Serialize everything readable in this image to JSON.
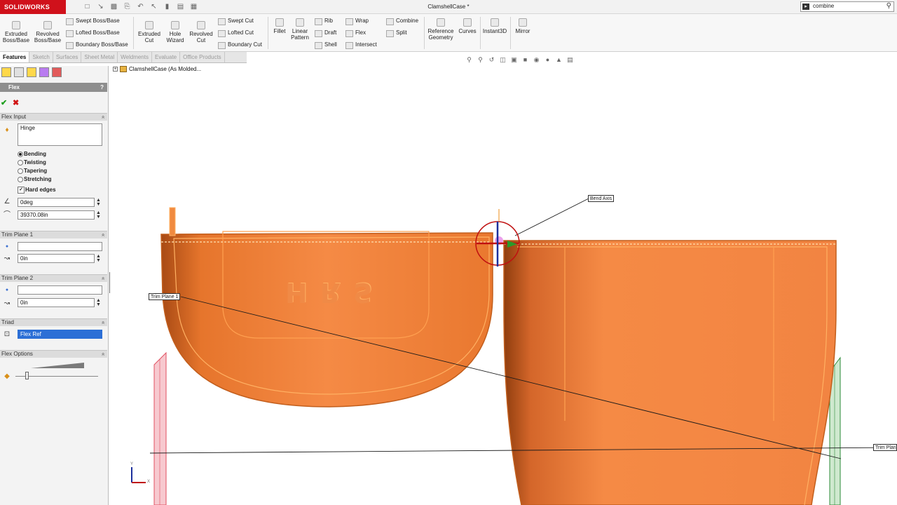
{
  "app": {
    "logo_text": "SOLIDWORKS",
    "document_title": "ClamshellCase *",
    "search_value": "combine",
    "search_icon": "magnifier-icon"
  },
  "ribbon": {
    "extruded_boss": "Extruded Boss/Base",
    "revolved_boss": "Revolved Boss/Base",
    "swept_boss": "Swept Boss/Base",
    "lofted_boss": "Lofted Boss/Base",
    "boundary_boss": "Boundary Boss/Base",
    "extruded_cut": "Extruded Cut",
    "hole_wizard": "Hole Wizard",
    "revolved_cut": "Revolved Cut",
    "swept_cut": "Swept Cut",
    "lofted_cut": "Lofted Cut",
    "boundary_cut": "Boundary Cut",
    "fillet": "Fillet",
    "linear_pattern": "Linear Pattern",
    "rib": "Rib",
    "draft": "Draft",
    "shell": "Shell",
    "wrap": "Wrap",
    "flex": "Flex",
    "intersect": "Intersect",
    "combine": "Combine",
    "split": "Split",
    "reference_geometry": "Reference Geometry",
    "curves": "Curves",
    "instant3d": "Instant3D",
    "mirror": "Mirror"
  },
  "tabs": [
    "Features",
    "Sketch",
    "Surfaces",
    "Sheet Metal",
    "Weldments",
    "Evaluate",
    "Office Products"
  ],
  "panel": {
    "title": "Flex",
    "help": "?",
    "flex_input_header": "Flex Input",
    "bodies_value": "Hinge",
    "options": [
      "Bending",
      "Twisting",
      "Tapering",
      "Stretching"
    ],
    "selected_option": "Bending",
    "hard_edges_label": "Hard edges",
    "hard_edges_checked": true,
    "angle_value": "0deg",
    "radius_value": "39370.08in",
    "trim1_header": "Trim Plane 1",
    "trim1_offset": "0in",
    "trim2_header": "Trim Plane 2",
    "trim2_offset": "0in",
    "triad_header": "Triad",
    "triad_value": "Flex Ref",
    "flex_options_header": "Flex Options"
  },
  "tree": {
    "root_label": "ClamshellCase  (As Molded..."
  },
  "graphics": {
    "bend_axis_label": "Bend Axis",
    "trim_plane1_label": "Trim Plane 1",
    "trim_plane2_label": "Trim Plan",
    "embossed_text": "HRS",
    "triad_y": "Y",
    "triad_x": "X"
  },
  "colors": {
    "part_orange": "#f0823a",
    "part_dark": "#b5561c",
    "edge_highlight": "#ffb347",
    "trim_plane1": "#e05060",
    "trim_plane2": "#2e8b3a",
    "selection_blue": "#2c6fd6",
    "brand_red": "#d0111b"
  }
}
